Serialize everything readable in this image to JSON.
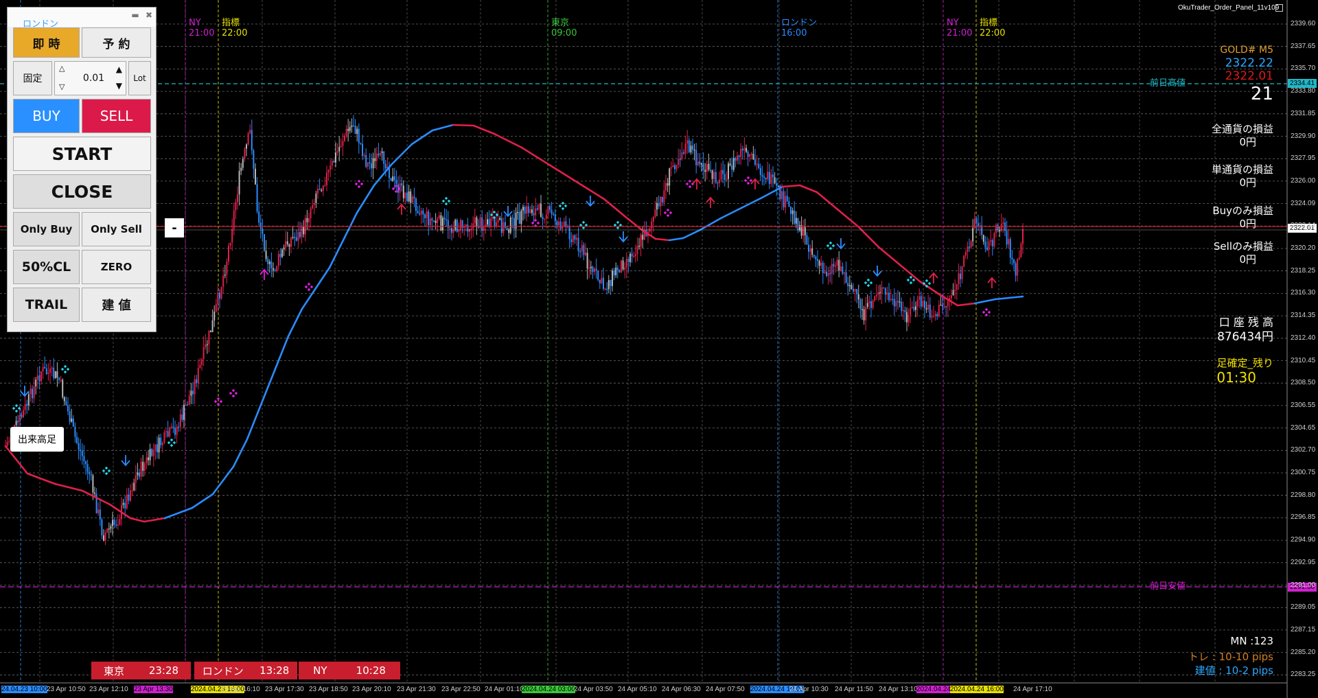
{
  "window": {
    "indicator_name": "OkuTrader_Order_Panel_11v109"
  },
  "panel": {
    "header_title": "ロンドン",
    "minimize": "▬",
    "close": "✖",
    "instant_label": "即 時",
    "reserve_label": "予 約",
    "fixed_label": "固定",
    "lot_value": "0.01",
    "lot_label": "Lot",
    "buy_label": "BUY",
    "sell_label": "SELL",
    "start_label": "START",
    "close_label": "CLOSE",
    "only_buy_label": "Only Buy",
    "only_sell_label": "Only Sell",
    "half_close_label": "50%CL",
    "zero_label": "ZERO",
    "trail_label": "TRAIL",
    "breakeven_label": "建 値",
    "collapse_label": "-"
  },
  "volume_label": "出来高足",
  "sessions_top": [
    {
      "name": "NY",
      "time": "21:00",
      "color": "#d020d0"
    },
    {
      "name": "指標",
      "time": "22:00",
      "color": "#e8e000"
    },
    {
      "name": "東京",
      "time": "09:00",
      "color": "#38c838"
    },
    {
      "name": "ロンドン",
      "time": "16:00",
      "color": "#2a8cff"
    },
    {
      "name": "NY",
      "time": "21:00",
      "color": "#d020d0"
    },
    {
      "name": "指標",
      "time": "22:00",
      "color": "#e8e000"
    }
  ],
  "prev_day_high_label": "前日高値",
  "prev_day_low_label": "前日安値",
  "info": {
    "symbol": "GOLD# M5",
    "bid": "2322.22",
    "ask": "2322.01",
    "spread": "21",
    "all_pl_label": "全通貨の損益",
    "all_pl_value": "0円",
    "single_pl_label": "単通貨の損益",
    "single_pl_value": "0円",
    "buy_pl_label": "Buyのみ損益",
    "buy_pl_value": "0円",
    "sell_pl_label": "Sellのみ損益",
    "sell_pl_value": "0円",
    "balance_label": "口 座 残 高",
    "balance_value": "876434円",
    "bar_remain_label": "足確定_残り",
    "bar_remain_value": "01:30",
    "magic": "MN :123",
    "trail_info": "トレ : 10-10 pips",
    "be_info": "建値 : 10-2 pips"
  },
  "session_clocks": [
    {
      "name": "東京",
      "time": "23:28"
    },
    {
      "name": "ロンドン",
      "time": "13:28"
    },
    {
      "name": "NY",
      "time": "10:28"
    }
  ],
  "price_axis": {
    "labels": [
      "2339.60",
      "2337.65",
      "2335.70",
      "2333.80",
      "2331.85",
      "2329.90",
      "2327.95",
      "2326.00",
      "2324.09",
      "2322.14",
      "2320.20",
      "2318.25",
      "2316.30",
      "2314.35",
      "2312.40",
      "2310.45",
      "2308.50",
      "2306.55",
      "2304.65",
      "2302.70",
      "2300.75",
      "2298.80",
      "2296.85",
      "2294.90",
      "2292.95",
      "2291.00",
      "2289.05",
      "2287.15",
      "2285.20",
      "2283.25"
    ],
    "prev_high_tag": "2334.41",
    "current_tag": "2322.01",
    "prev_low_tag": "2291.30"
  },
  "time_axis": {
    "labels": [
      "24.04.23 10:00",
      "23 Apr 10:50",
      "23 Apr 12:10",
      "23 Apr 13:30",
      "2024.04.23 16:00",
      "23 Apr 16:10",
      "23 Apr 17:30",
      "23 Apr 18:50",
      "23 Apr 20:10",
      "23 Apr 21:30",
      "23 Apr 22:50",
      "24 Apr 01:10",
      "2024.04.24 03:00",
      "24 Apr 03:50",
      "24 Apr 05:10",
      "24 Apr 06:30",
      "24 Apr 07:50",
      "2024.04.24 10:00",
      "24 Apr 10:30",
      "24 Apr 11:50",
      "24 Apr 13:10",
      "2024.04.24 14:30",
      "2024.04.24 16:00",
      "24 Apr 17:10"
    ]
  },
  "colors": {
    "bull": "#e0204a",
    "bear": "#2a8cff",
    "neutral": "#b8b8b8",
    "ma_up": "#2a8cff",
    "ma_down": "#e0204a",
    "prev_high": "#20b8c8",
    "prev_low": "#d020d0"
  }
}
